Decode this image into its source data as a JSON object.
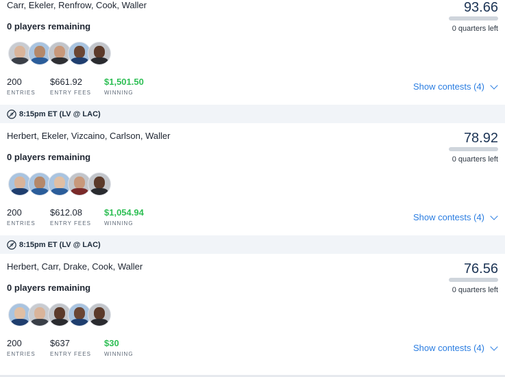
{
  "cards": [
    {
      "header": null,
      "players": "Carr, Ekeler, Renfrow, Cook, Waller",
      "remaining": "0 players remaining",
      "score": "93.66",
      "quarters_left": "0 quarters left",
      "entries": "200",
      "entries_label": "ENTRIES",
      "fees": "$661.92",
      "fees_label": "ENTRY FEES",
      "winning": "$1,501.50",
      "winning_label": "WINNING",
      "show_contests": "Show contests (4)"
    },
    {
      "header": "8:15pm ET (LV @ LAC)",
      "players": "Herbert, Ekeler, Vizcaino, Carlson, Waller",
      "remaining": "0 players remaining",
      "score": "78.92",
      "quarters_left": "0 quarters left",
      "entries": "200",
      "entries_label": "ENTRIES",
      "fees": "$612.08",
      "fees_label": "ENTRY FEES",
      "winning": "$1,054.94",
      "winning_label": "WINNING",
      "show_contests": "Show contests (4)"
    },
    {
      "header": "8:15pm ET (LV @ LAC)",
      "players": "Herbert, Carr, Drake, Cook, Waller",
      "remaining": "0 players remaining",
      "score": "76.56",
      "quarters_left": "0 quarters left",
      "entries": "200",
      "entries_label": "ENTRIES",
      "fees": "$637",
      "fees_label": "ENTRY FEES",
      "winning": "$30",
      "winning_label": "WINNING",
      "show_contests": "Show contests (4)"
    }
  ],
  "icons": {
    "football": "football-icon",
    "chevron": "chevron-down-icon"
  },
  "colors": {
    "accent": "#2a7de1",
    "winning": "#2fbf55",
    "header_bg": "#f1f4f8"
  }
}
